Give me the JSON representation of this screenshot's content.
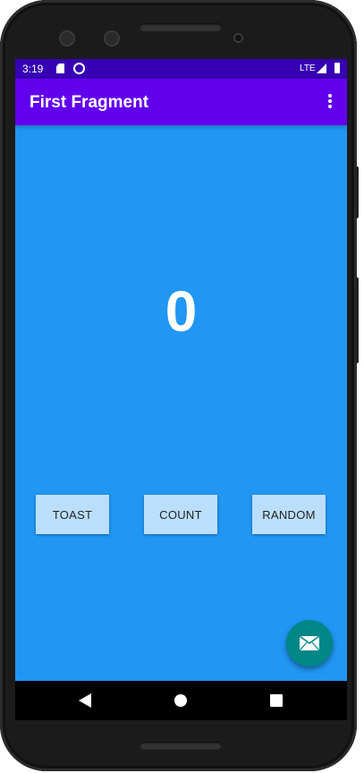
{
  "status_bar": {
    "time": "3:19",
    "network": "LTE"
  },
  "app_bar": {
    "title": "First Fragment",
    "menu_icon": "overflow-menu-icon"
  },
  "main": {
    "count": "0"
  },
  "buttons": {
    "toast": "TOAST",
    "count": "COUNT",
    "random": "RANDOM"
  },
  "fab": {
    "icon": "email-icon"
  },
  "nav": {
    "back": "back-icon",
    "home": "home-icon",
    "recents": "recents-icon"
  },
  "colors": {
    "status_bar": "#3700b3",
    "app_bar": "#6200ee",
    "background": "#2196f3",
    "button": "#bbdefb",
    "fab": "#018786"
  }
}
